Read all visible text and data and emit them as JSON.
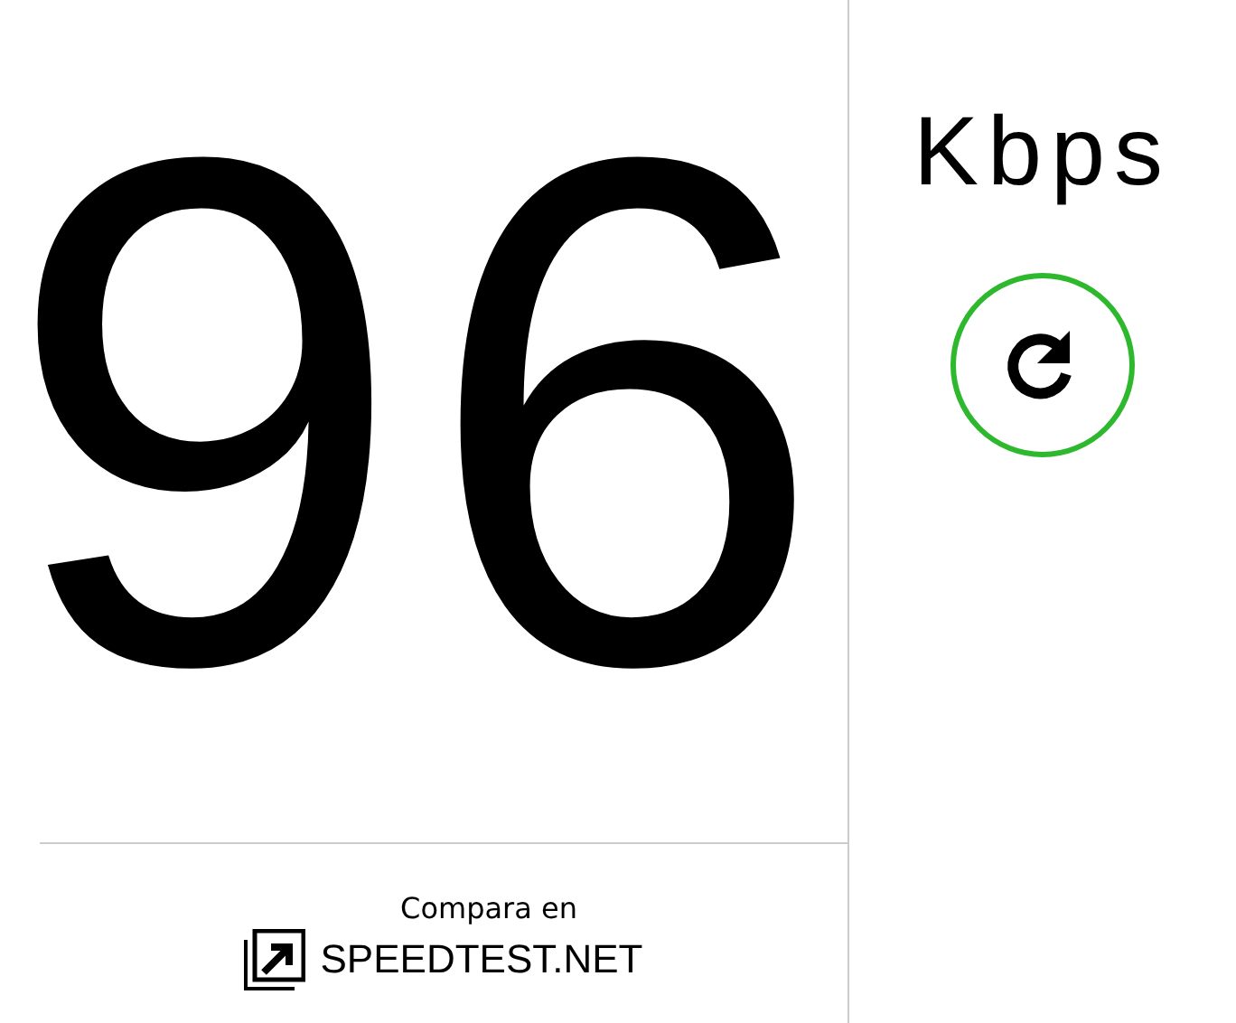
{
  "speed": {
    "value": "96",
    "unit": "Kbps"
  },
  "compare": {
    "label": "Compara en",
    "link": "SPEEDTEST.NET"
  }
}
